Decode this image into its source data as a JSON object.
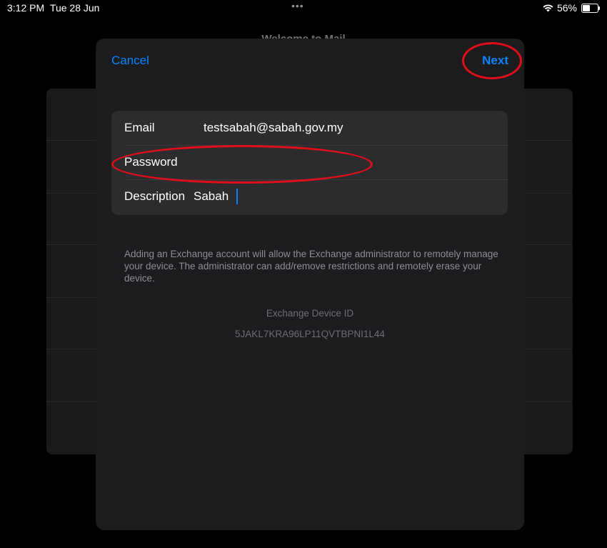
{
  "status_bar": {
    "time": "3:12 PM",
    "date": "Tue 28 Jun",
    "dots": "•••",
    "battery_percent": "56%",
    "battery_level": 0.56,
    "wifi_icon": "wifi-icon",
    "battery_icon": "battery-icon"
  },
  "background": {
    "title": "Welcome to Mail"
  },
  "sheet": {
    "cancel_label": "Cancel",
    "next_label": "Next",
    "fields": [
      {
        "label": "Email",
        "value": "testsabah@sabah.gov.my",
        "placeholder": ""
      },
      {
        "label": "Password",
        "value": "",
        "placeholder": ""
      },
      {
        "label": "Description",
        "value": "Sabah",
        "placeholder": ""
      }
    ],
    "notice": "Adding an Exchange account will allow the Exchange administrator to remotely manage your device. The administrator can add/remove restrictions and remotely erase your device.",
    "device_id_label": "Exchange Device ID",
    "device_id_value": "5JAKL7KRA96LP11QVTBPNI1L44"
  },
  "colors": {
    "accent": "#0a84ff",
    "annotation": "#e00e1a",
    "sheet_bg": "#1c1c1e",
    "field_bg": "#2c2c2e"
  }
}
